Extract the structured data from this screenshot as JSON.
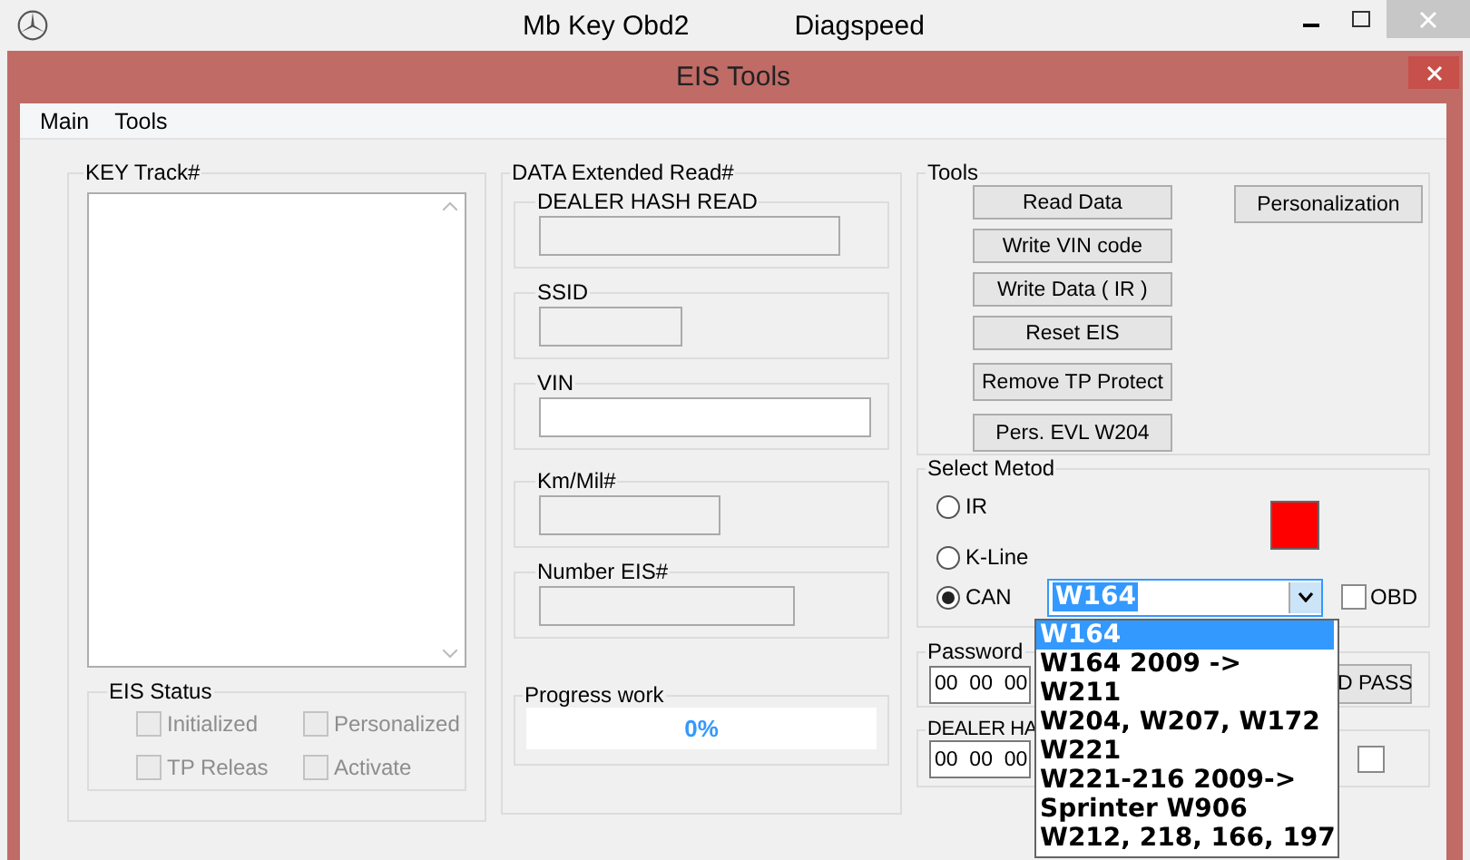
{
  "outer_window": {
    "title": "Mb Key Obd2",
    "subtitle": "Diagspeed"
  },
  "window": {
    "title": "EIS Tools"
  },
  "menu": [
    "Main",
    "Tools"
  ],
  "key_track": {
    "title": "KEY Track#",
    "status": {
      "title": "EIS Status",
      "checkboxes": [
        {
          "label": "Initialized",
          "checked": false,
          "disabled": true
        },
        {
          "label": "Personalized",
          "checked": false,
          "disabled": true
        },
        {
          "label": "TP Releas",
          "checked": false,
          "disabled": true
        },
        {
          "label": "Activate",
          "checked": false,
          "disabled": true
        }
      ]
    }
  },
  "data_read": {
    "title": "DATA Extended Read#",
    "fields": [
      {
        "label": "DEALER HASH READ",
        "disabled": true
      },
      {
        "label": "SSID",
        "disabled": true
      },
      {
        "label": "VIN",
        "disabled": false
      },
      {
        "label": "Km/Mil#",
        "disabled": true
      },
      {
        "label": "Number EIS#",
        "disabled": true
      }
    ],
    "progress": {
      "title": "Progress work",
      "level": 0,
      "reading": "0%"
    }
  },
  "tools": {
    "title": "Tools",
    "buttons": [
      "Read Data",
      "Write VIN code",
      "Write Data ( IR )",
      "Reset EIS",
      "Remove TP Protect",
      "Pers. EVL W204"
    ],
    "side_button": "Personalization"
  },
  "method": {
    "title": "Select Metod",
    "connected": false,
    "options": [
      {
        "label": "IR",
        "selected": false
      },
      {
        "label": "K-Line",
        "selected": false
      },
      {
        "label": "CAN",
        "selected": true
      }
    ],
    "model": {
      "value": "W164",
      "expanded": true,
      "items": [
        {
          "label": "W164",
          "selected": true
        },
        {
          "label": "W164 2009 ->",
          "selected": false
        },
        {
          "label": "W211",
          "selected": false
        },
        {
          "label": "W204, W207, W172",
          "selected": false
        },
        {
          "label": "W221",
          "selected": false
        },
        {
          "label": "W221-216 2009->",
          "selected": false
        },
        {
          "label": "Sprinter W906",
          "selected": false
        },
        {
          "label": "W212, 218, 166, 197",
          "selected": false
        }
      ]
    },
    "obd": {
      "label": "OBD",
      "checked": false
    }
  },
  "password": {
    "title": "Password",
    "value": "00  00  00",
    "button": "D PASS"
  },
  "dealer_hash": {
    "title": "DEALER HA",
    "value": "00  00  00",
    "checked": false
  }
}
